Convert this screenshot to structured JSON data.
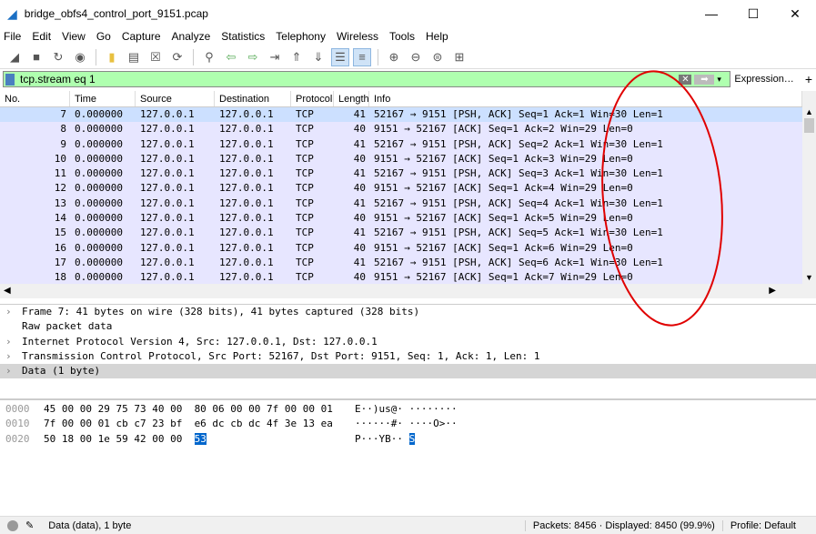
{
  "window": {
    "title": "bridge_obfs4_control_port_9151.pcap",
    "minimize": "—",
    "maximize": "☐",
    "close": "✕"
  },
  "menu": [
    "File",
    "Edit",
    "View",
    "Go",
    "Capture",
    "Analyze",
    "Statistics",
    "Telephony",
    "Wireless",
    "Tools",
    "Help"
  ],
  "toolbar": [
    "shark-fin-icon",
    "stop-icon",
    "restart-icon",
    "options-icon",
    "open-icon",
    "save-icon",
    "close-file-icon",
    "reload-icon",
    "find-icon",
    "back-icon",
    "forward-icon",
    "goto-icon",
    "first-icon",
    "last-icon",
    "autoscroll-icon",
    "colorize-icon",
    "zoom-in-icon",
    "zoom-out-icon",
    "zoom-reset-icon",
    "resize-columns-icon"
  ],
  "filter": {
    "value": "tcp.stream eq 1",
    "expression_label": "Expression…",
    "add_label": "+"
  },
  "columns": [
    "No.",
    "Time",
    "Source",
    "Destination",
    "Protocol",
    "Length",
    "Info"
  ],
  "packets": [
    [
      "7",
      "0.000000",
      "127.0.0.1",
      "127.0.0.1",
      "TCP",
      "41",
      "52167 → 9151 [PSH, ACK] Seq=1 Ack=1 Win=30 Len=1"
    ],
    [
      "8",
      "0.000000",
      "127.0.0.1",
      "127.0.0.1",
      "TCP",
      "40",
      "9151 → 52167 [ACK] Seq=1 Ack=2 Win=29 Len=0"
    ],
    [
      "9",
      "0.000000",
      "127.0.0.1",
      "127.0.0.1",
      "TCP",
      "41",
      "52167 → 9151 [PSH, ACK] Seq=2 Ack=1 Win=30 Len=1"
    ],
    [
      "10",
      "0.000000",
      "127.0.0.1",
      "127.0.0.1",
      "TCP",
      "40",
      "9151 → 52167 [ACK] Seq=1 Ack=3 Win=29 Len=0"
    ],
    [
      "11",
      "0.000000",
      "127.0.0.1",
      "127.0.0.1",
      "TCP",
      "41",
      "52167 → 9151 [PSH, ACK] Seq=3 Ack=1 Win=30 Len=1"
    ],
    [
      "12",
      "0.000000",
      "127.0.0.1",
      "127.0.0.1",
      "TCP",
      "40",
      "9151 → 52167 [ACK] Seq=1 Ack=4 Win=29 Len=0"
    ],
    [
      "13",
      "0.000000",
      "127.0.0.1",
      "127.0.0.1",
      "TCP",
      "41",
      "52167 → 9151 [PSH, ACK] Seq=4 Ack=1 Win=30 Len=1"
    ],
    [
      "14",
      "0.000000",
      "127.0.0.1",
      "127.0.0.1",
      "TCP",
      "40",
      "9151 → 52167 [ACK] Seq=1 Ack=5 Win=29 Len=0"
    ],
    [
      "15",
      "0.000000",
      "127.0.0.1",
      "127.0.0.1",
      "TCP",
      "41",
      "52167 → 9151 [PSH, ACK] Seq=5 Ack=1 Win=30 Len=1"
    ],
    [
      "16",
      "0.000000",
      "127.0.0.1",
      "127.0.0.1",
      "TCP",
      "40",
      "9151 → 52167 [ACK] Seq=1 Ack=6 Win=29 Len=0"
    ],
    [
      "17",
      "0.000000",
      "127.0.0.1",
      "127.0.0.1",
      "TCP",
      "41",
      "52167 → 9151 [PSH, ACK] Seq=6 Ack=1 Win=30 Len=1"
    ],
    [
      "18",
      "0.000000",
      "127.0.0.1",
      "127.0.0.1",
      "TCP",
      "40",
      "9151 → 52167 [ACK] Seq=1 Ack=7 Win=29 Len=0"
    ]
  ],
  "details": [
    {
      "text": "Frame 7: 41 bytes on wire (328 bits), 41 bytes captured (328 bits)",
      "expandable": true
    },
    {
      "text": "Raw packet data",
      "expandable": false
    },
    {
      "text": "Internet Protocol Version 4, Src: 127.0.0.1, Dst: 127.0.0.1",
      "expandable": true
    },
    {
      "text": "Transmission Control Protocol, Src Port: 52167, Dst Port: 9151, Seq: 1, Ack: 1, Len: 1",
      "expandable": true
    },
    {
      "text": "Data (1 byte)",
      "expandable": true,
      "selected": true
    }
  ],
  "hex": [
    {
      "offset": "0000",
      "bytes": "45 00 00 29 75 73 40 00  80 06 00 00 7f 00 00 01",
      "ascii": "E··)us@· ········"
    },
    {
      "offset": "0010",
      "bytes": "7f 00 00 01 cb c7 23 bf  e6 dc cb dc 4f 3e 13 ea",
      "ascii": "······#· ····O>··"
    },
    {
      "offset": "0020",
      "bytes": "50 18 00 1e 59 42 00 00  ",
      "highlight": "53",
      "ascii": "P···YB·· ",
      "ascii_highlight": "S"
    }
  ],
  "status": {
    "field": "Data (data), 1 byte",
    "packets": "Packets: 8456 · Displayed: 8450 (99.9%)",
    "profile": "Profile: Default"
  },
  "annotation_color": "#e00000"
}
